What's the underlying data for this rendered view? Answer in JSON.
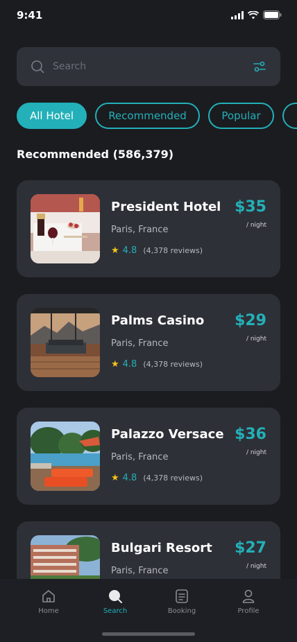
{
  "status": {
    "time": "9:41"
  },
  "search": {
    "placeholder": "Search"
  },
  "chips": [
    {
      "label": "All Hotel",
      "active": true
    },
    {
      "label": "Recommended",
      "active": false
    },
    {
      "label": "Popular",
      "active": false
    }
  ],
  "section": {
    "title": "Recommended (586,379)"
  },
  "hotels": [
    {
      "name": "President Hotel",
      "location": "Paris, France",
      "rating": "4.8",
      "reviews": "(4,378 reviews)",
      "price": "$35",
      "per": "/ night"
    },
    {
      "name": "Palms Casino",
      "location": "Paris, France",
      "rating": "4.8",
      "reviews": "(4,378 reviews)",
      "price": "$29",
      "per": "/ night"
    },
    {
      "name": "Palazzo Versace",
      "location": "Paris, France",
      "rating": "4.8",
      "reviews": "(4,378 reviews)",
      "price": "$36",
      "per": "/ night"
    },
    {
      "name": "Bulgari Resort",
      "location": "Paris, France",
      "price": "$27",
      "per": "/ night"
    }
  ],
  "tabs": [
    {
      "label": "Home",
      "icon": "home-icon"
    },
    {
      "label": "Search",
      "icon": "search-icon",
      "active": true
    },
    {
      "label": "Booking",
      "icon": "document-icon"
    },
    {
      "label": "Profile",
      "icon": "user-icon"
    }
  ],
  "colors": {
    "accent": "#23b0b8",
    "background": "#1a1c20",
    "card": "#2e3037",
    "star": "#f5c518"
  }
}
